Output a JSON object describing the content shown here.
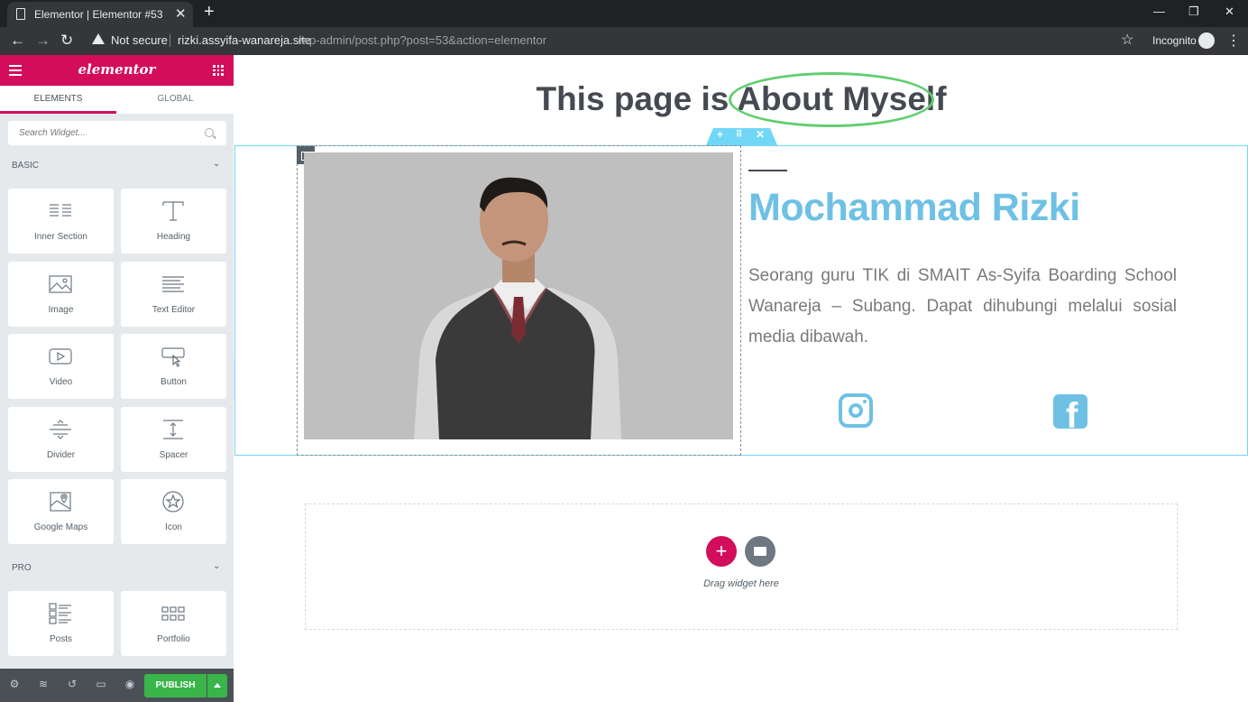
{
  "browser": {
    "tab_title": "Elementor | Elementor #53",
    "new_tab": "+",
    "not_secure": "Not secure",
    "url_host": "rizki.assyifa-wanareja.site",
    "url_path": "/wp-admin/post.php?post=53&action=elementor",
    "incognito": "Incognito"
  },
  "panel": {
    "brand": "elementor",
    "tabs": {
      "elements": "ELEMENTS",
      "global": "GLOBAL"
    },
    "search_placeholder": "Search Widget...",
    "categories": {
      "basic": "BASIC",
      "pro": "PRO"
    },
    "basic_widgets": [
      {
        "label": "Inner Section",
        "icon": "inner-section-icon"
      },
      {
        "label": "Heading",
        "icon": "heading-icon"
      },
      {
        "label": "Image",
        "icon": "image-icon"
      },
      {
        "label": "Text Editor",
        "icon": "text-editor-icon"
      },
      {
        "label": "Video",
        "icon": "video-icon"
      },
      {
        "label": "Button",
        "icon": "button-icon"
      },
      {
        "label": "Divider",
        "icon": "divider-icon"
      },
      {
        "label": "Spacer",
        "icon": "spacer-icon"
      },
      {
        "label": "Google Maps",
        "icon": "google-maps-icon"
      },
      {
        "label": "Icon",
        "icon": "star-icon"
      }
    ],
    "pro_widgets": [
      {
        "label": "Posts",
        "icon": "posts-icon"
      },
      {
        "label": "Portfolio",
        "icon": "portfolio-icon"
      }
    ],
    "publish_label": "PUBLISH"
  },
  "page": {
    "heading_prefix": "This page is ",
    "heading_highlight": "About Myself",
    "name": "Mochammad Rizki",
    "bio": "Seorang guru TIK di SMAIT As-Syifa Boarding School Wanareja – Subang. Dapat dihubungi melalui sosial media dibawah.",
    "drag_text": "Drag widget here"
  },
  "colors": {
    "brand": "#d30c5c",
    "accent_blue": "#6ec1e4",
    "highlight_green": "#61ce70",
    "publish_green": "#39b54a"
  }
}
